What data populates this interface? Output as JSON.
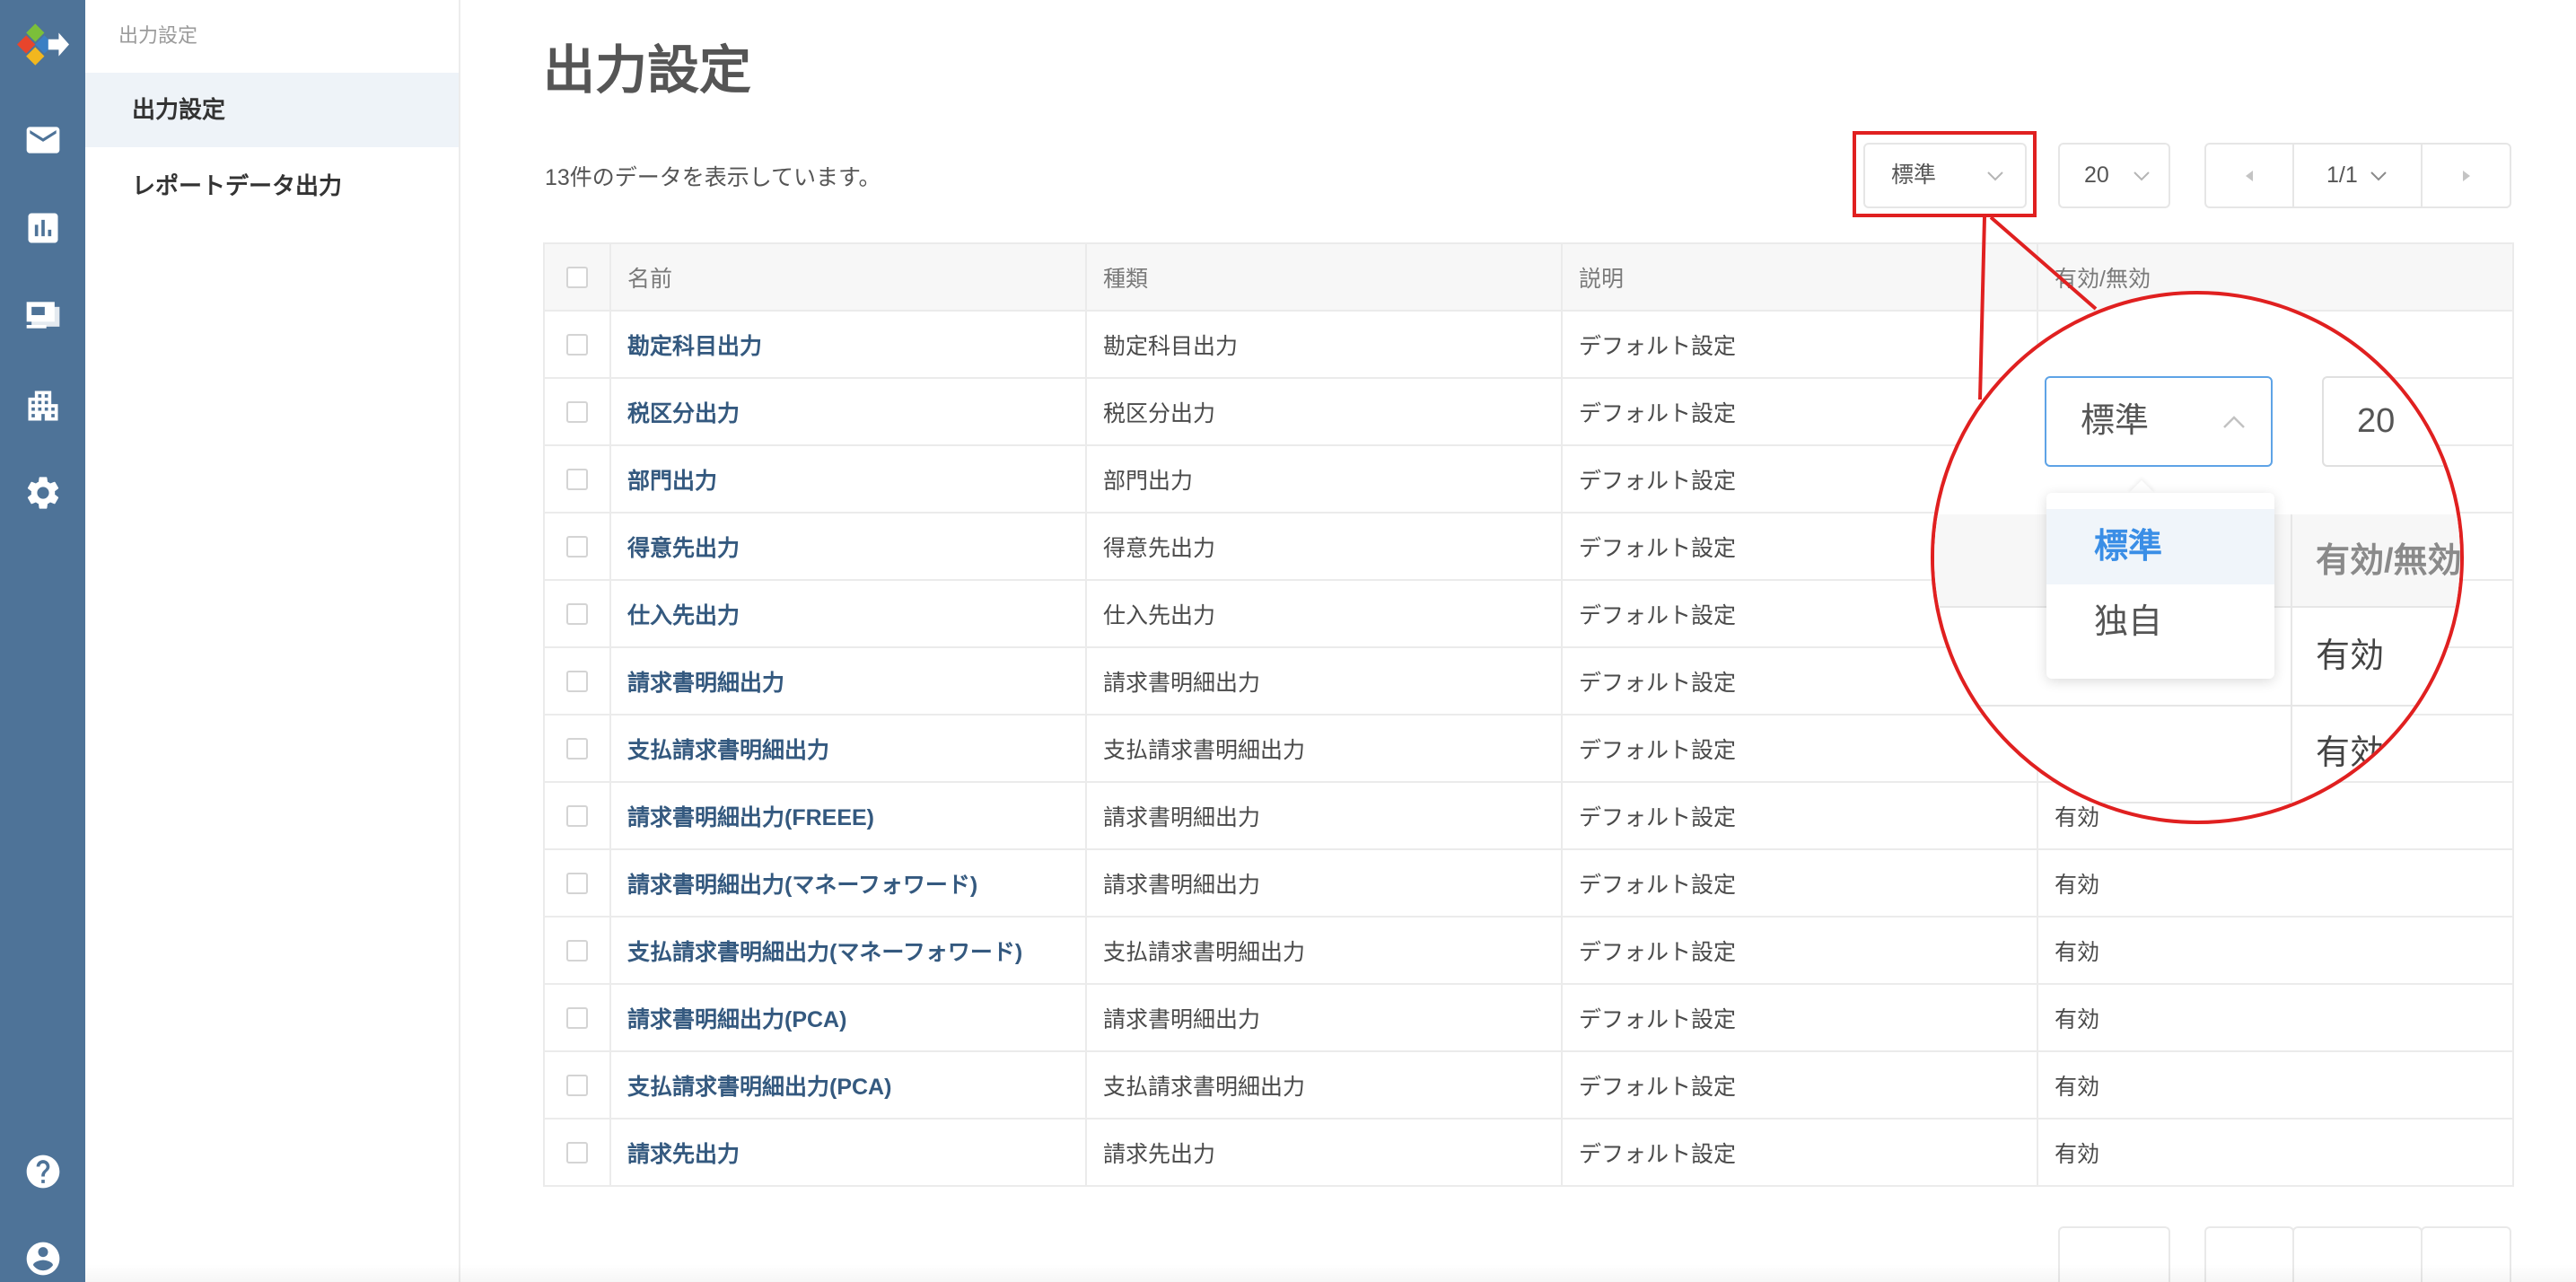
{
  "colors": {
    "rail": "#4e7398",
    "accent": "#3a8ee6",
    "highlight": "#e02020",
    "link": "#34597f"
  },
  "rail": {
    "icons": [
      "logo",
      "mail-icon",
      "chart-icon",
      "presentation-icon",
      "building-icon",
      "gear-icon",
      "help-icon",
      "user-icon"
    ]
  },
  "sidebar": {
    "section_title": "出力設定",
    "items": [
      {
        "label": "出力設定",
        "active": true
      },
      {
        "label": "レポートデータ出力",
        "active": false
      }
    ]
  },
  "main": {
    "title": "出力設定",
    "summary": "13件のデータを表示しています。",
    "toolbar": {
      "format_select": "標準",
      "page_size": "20",
      "pagination": "1/1"
    },
    "table": {
      "headers": {
        "name": "名前",
        "type": "種類",
        "description": "説明",
        "status": "有効/無効"
      },
      "rows": [
        {
          "name": "勘定科目出力",
          "type": "勘定科目出力",
          "description": "デフォルト設定"
        },
        {
          "name": "税区分出力",
          "type": "税区分出力",
          "description": "デフォルト設定"
        },
        {
          "name": "部門出力",
          "type": "部門出力",
          "description": "デフォルト設定"
        },
        {
          "name": "得意先出力",
          "type": "得意先出力",
          "description": "デフォルト設定"
        },
        {
          "name": "仕入先出力",
          "type": "仕入先出力",
          "description": "デフォルト設定"
        },
        {
          "name": "請求書明細出力",
          "type": "請求書明細出力",
          "description": "デフォルト設定"
        },
        {
          "name": "支払請求書明細出力",
          "type": "支払請求書明細出力",
          "description": "デフォルト設定"
        },
        {
          "name": "請求書明細出力(FREEE)",
          "type": "請求書明細出力",
          "description": "デフォルト設定",
          "status": "有効"
        },
        {
          "name": "請求書明細出力(マネーフォワード)",
          "type": "請求書明細出力",
          "description": "デフォルト設定",
          "status": "有効"
        },
        {
          "name": "支払請求書明細出力(マネーフォワード)",
          "type": "支払請求書明細出力",
          "description": "デフォルト設定",
          "status": "有効"
        },
        {
          "name": "請求書明細出力(PCA)",
          "type": "請求書明細出力",
          "description": "デフォルト設定",
          "status": "有効"
        },
        {
          "name": "支払請求書明細出力(PCA)",
          "type": "支払請求書明細出力",
          "description": "デフォルト設定",
          "status": "有効"
        },
        {
          "name": "請求先出力",
          "type": "請求先出力",
          "description": "デフォルト設定",
          "status": "有効"
        }
      ]
    }
  },
  "zoom_callout": {
    "format_select": "標準",
    "page_size": "20",
    "options": [
      {
        "label": "標準",
        "selected": true
      },
      {
        "label": "独自",
        "selected": false
      }
    ],
    "column_header": "有効/無効",
    "cells": [
      "有効",
      "有効"
    ]
  }
}
